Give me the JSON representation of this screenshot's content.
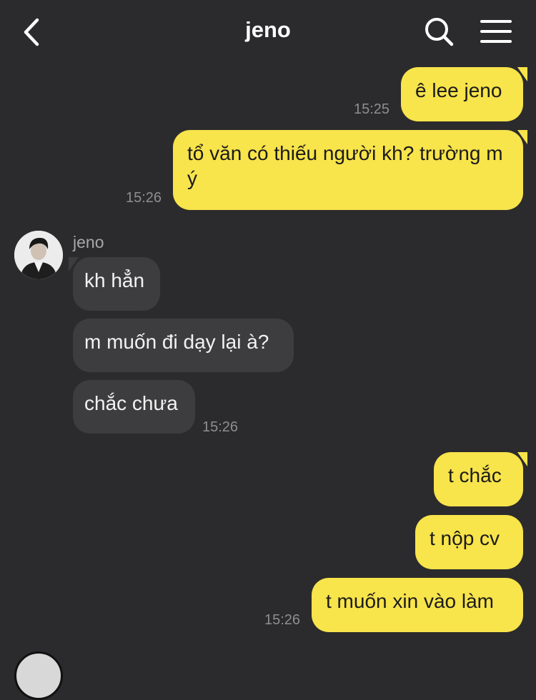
{
  "header": {
    "title": "jeno",
    "back_icon": "chevron-left-icon",
    "search_icon": "search-icon",
    "menu_icon": "menu-icon"
  },
  "messages": [
    {
      "side": "out",
      "text": "ê lee jeno",
      "time": "15:25"
    },
    {
      "side": "out",
      "text": "tổ văn có thiếu người kh? trường m ý",
      "time": "15:26"
    },
    {
      "side": "in",
      "sender": "jeno",
      "text": "kh hẳn"
    },
    {
      "side": "in",
      "text": "m muốn đi dạy lại à?"
    },
    {
      "side": "in",
      "text": "chắc chưa",
      "time": "15:26"
    },
    {
      "side": "out",
      "text": "t chắc"
    },
    {
      "side": "out",
      "text": "t nộp cv"
    },
    {
      "side": "out",
      "text": "t muốn xin vào làm",
      "time": "15:26"
    }
  ],
  "colors": {
    "background": "#2b2b2d",
    "outgoing_bubble": "#f8e44b",
    "incoming_bubble": "#3d3d3f",
    "timestamp": "#8e8e90"
  }
}
